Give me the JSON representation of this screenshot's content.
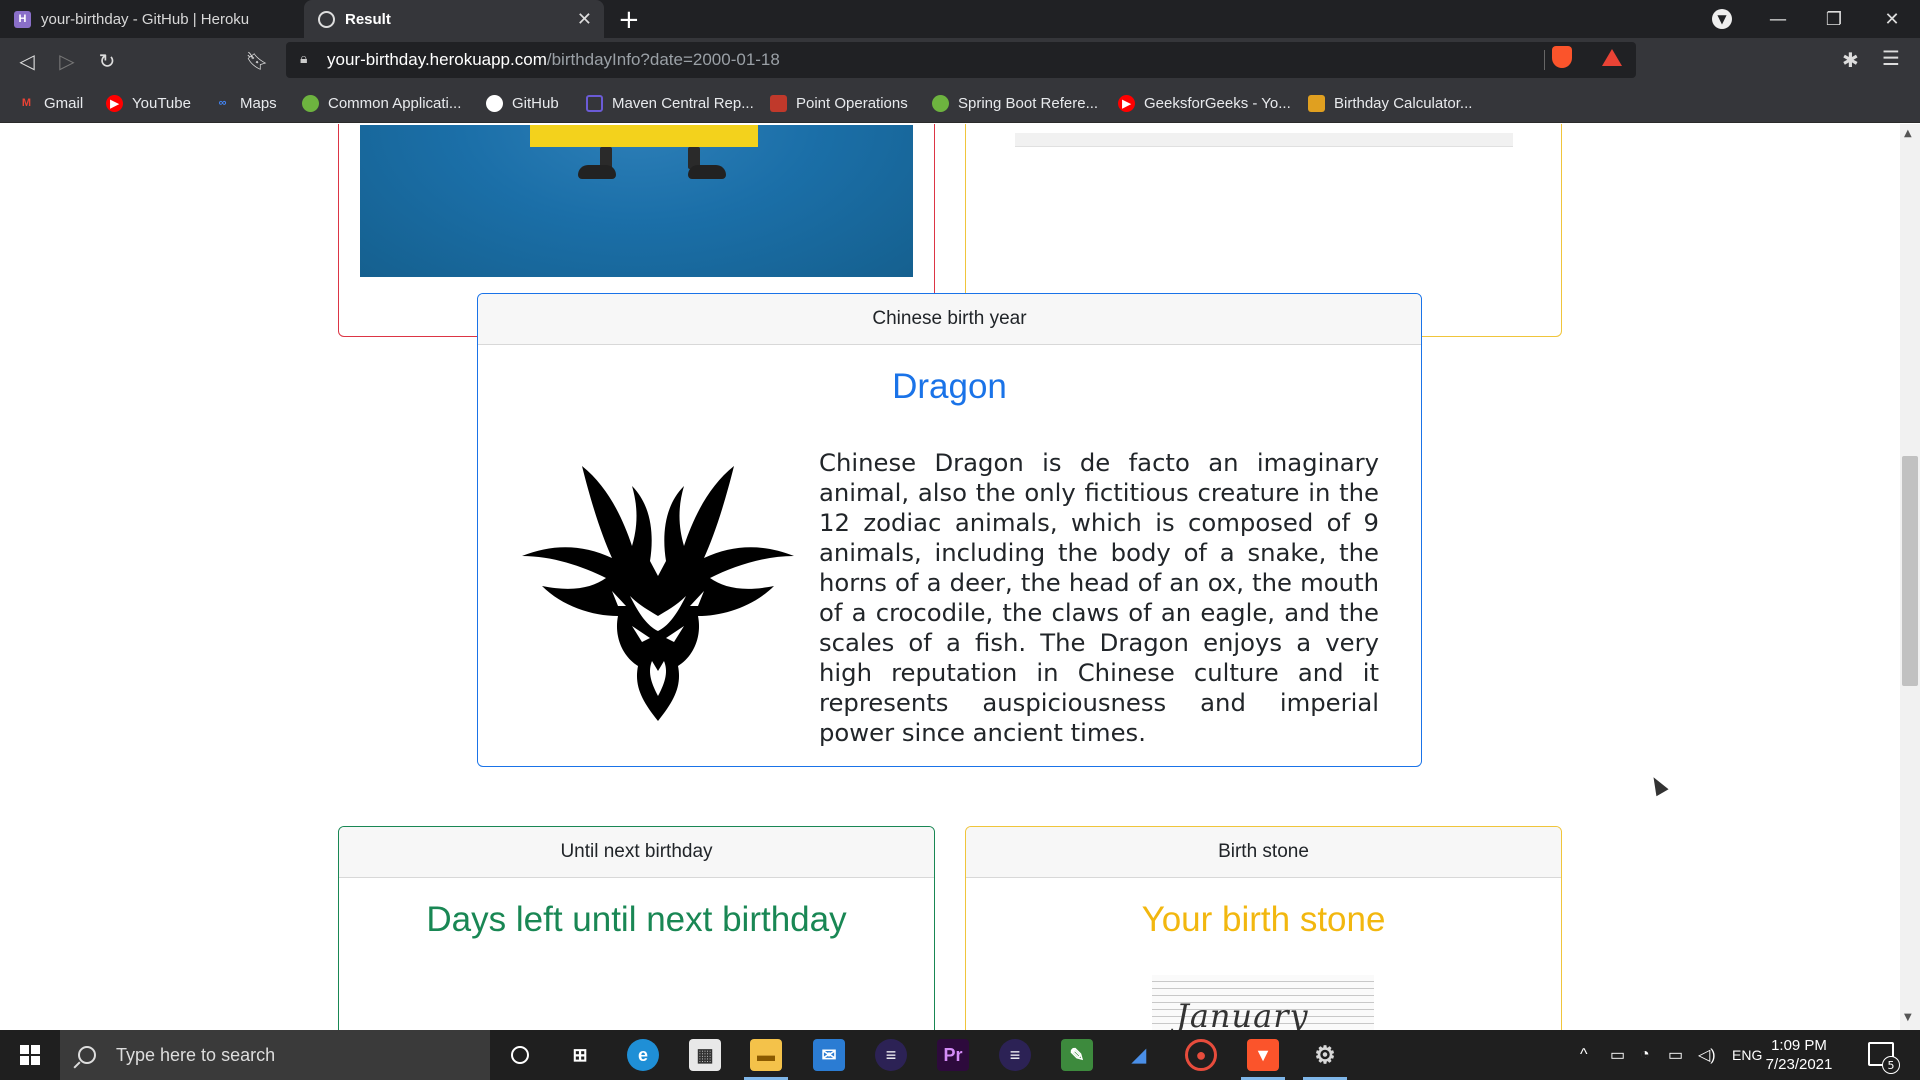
{
  "browser": {
    "tabs": [
      {
        "title": "your-birthday - GitHub | Heroku",
        "favicon": "H"
      },
      {
        "title": "Result",
        "active": true
      }
    ],
    "url_host": "your-birthday.herokuapp.com",
    "url_path": "/birthdayInfo?date=2000-01-18",
    "bookmarks": [
      {
        "label": "Gmail",
        "icon": "M",
        "color": "#ea4335"
      },
      {
        "label": "YouTube",
        "icon": "▶",
        "color": "#ff0000"
      },
      {
        "label": "Maps",
        "icon": "∞",
        "color": "#4285f4"
      },
      {
        "label": "Common Applicati...",
        "icon": "",
        "color": "#6db33f"
      },
      {
        "label": "GitHub",
        "icon": "",
        "color": "#ffffff"
      },
      {
        "label": "Maven Central Rep...",
        "icon": "",
        "color": "#6b5bd6"
      },
      {
        "label": "Point Operations",
        "icon": "",
        "color": "#c0392b"
      },
      {
        "label": "Spring Boot Refere...",
        "icon": "",
        "color": "#6db33f"
      },
      {
        "label": "GeeksforGeeks - Yo...",
        "icon": "▶",
        "color": "#ff0000"
      },
      {
        "label": "Birthday Calculator...",
        "icon": "",
        "color": "#e0a020"
      }
    ]
  },
  "page": {
    "chinese_card": {
      "header": "Chinese birth year",
      "title": "Dragon",
      "description": "Chinese Dragon is de facto an imaginary animal, also the only fictitious creature in the 12 zodiac animals, which is composed of 9 animals, including the body of a snake, the horns of a deer, the head of an ox, the mouth of a crocodile, the claws of an eagle, and the scales of a fish. The Dragon enjoys a very high reputation in Chinese culture and it represents auspiciousness and imperial power since ancient times."
    },
    "birthday_card": {
      "header": "Until next birthday",
      "title": "Days left until next birthday"
    },
    "stone_card": {
      "header": "Birth stone",
      "title": "Your birth stone",
      "image_text": "January"
    }
  },
  "taskbar": {
    "search_placeholder": "Type here to search",
    "language": "ENG",
    "time": "1:09 PM",
    "date": "7/23/2021",
    "notifications": "5"
  },
  "colors": {
    "primary": "#1a73e8",
    "success": "#198754",
    "warning": "#f2b70f",
    "danger": "#dc3545"
  }
}
